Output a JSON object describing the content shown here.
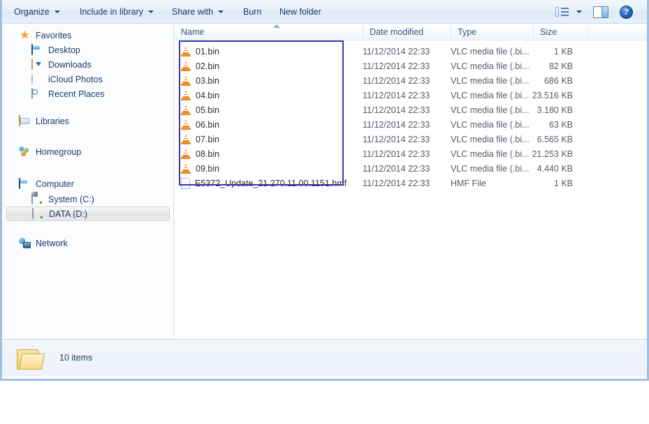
{
  "window": {
    "toolbar": {
      "organize_label": "Organize",
      "include_library_label": "Include in library",
      "share_with_label": "Share with",
      "burn_label": "Burn",
      "new_folder_label": "New folder",
      "views_icon": "view-options-icon",
      "views_caret_icon": "chevron-down-icon",
      "preview_pane_icon": "preview-pane-icon",
      "help_icon": "help-icon",
      "help_glyph": "?"
    },
    "sidebar": {
      "items": [
        {
          "label": "Favorites",
          "icon": "star-icon",
          "indent": 0,
          "selected": false
        },
        {
          "label": "Desktop",
          "icon": "desktop-icon",
          "indent": 1,
          "selected": false
        },
        {
          "label": "Downloads",
          "icon": "downloads-folder-icon",
          "indent": 1,
          "selected": false
        },
        {
          "label": "iCloud Photos",
          "icon": "icloud-photos-icon",
          "indent": 1,
          "selected": false
        },
        {
          "label": "Recent Places",
          "icon": "recent-places-icon",
          "indent": 1,
          "selected": false
        },
        {
          "label": "Libraries",
          "icon": "libraries-icon",
          "indent": 0,
          "selected": false
        },
        {
          "label": "Homegroup",
          "icon": "homegroup-icon",
          "indent": 0,
          "selected": false
        },
        {
          "label": "Computer",
          "icon": "computer-icon",
          "indent": 0,
          "selected": false
        },
        {
          "label": "System (C:)",
          "icon": "hard-drive-icon",
          "indent": 1,
          "selected": false
        },
        {
          "label": "DATA (D:)",
          "icon": "drive-icon",
          "indent": 1,
          "selected": true
        },
        {
          "label": "Network",
          "icon": "network-icon",
          "indent": 0,
          "selected": false
        }
      ]
    },
    "file_list": {
      "columns": {
        "name": "Name",
        "date_modified": "Date modified",
        "type": "Type",
        "size": "Size"
      },
      "sort_column": "Name",
      "sort_direction": "ascending",
      "rows": [
        {
          "name": "01.bin",
          "icon": "vlc-media-file-icon",
          "date": "11/12/2014 22:33",
          "type": "VLC media file (.bi...",
          "size": "1 KB"
        },
        {
          "name": "02.bin",
          "icon": "vlc-media-file-icon",
          "date": "11/12/2014 22:33",
          "type": "VLC media file (.bi...",
          "size": "82 KB"
        },
        {
          "name": "03.bin",
          "icon": "vlc-media-file-icon",
          "date": "11/12/2014 22:33",
          "type": "VLC media file (.bi...",
          "size": "686 KB"
        },
        {
          "name": "04.bin",
          "icon": "vlc-media-file-icon",
          "date": "11/12/2014 22:33",
          "type": "VLC media file (.bi...",
          "size": "23.516 KB"
        },
        {
          "name": "05.bin",
          "icon": "vlc-media-file-icon",
          "date": "11/12/2014 22:33",
          "type": "VLC media file (.bi...",
          "size": "3.180 KB"
        },
        {
          "name": "06.bin",
          "icon": "vlc-media-file-icon",
          "date": "11/12/2014 22:33",
          "type": "VLC media file (.bi...",
          "size": "63 KB"
        },
        {
          "name": "07.bin",
          "icon": "vlc-media-file-icon",
          "date": "11/12/2014 22:33",
          "type": "VLC media file (.bi...",
          "size": "6.565 KB"
        },
        {
          "name": "08.bin",
          "icon": "vlc-media-file-icon",
          "date": "11/12/2014 22:33",
          "type": "VLC media file (.bi...",
          "size": "21.253 KB"
        },
        {
          "name": "09.bin",
          "icon": "vlc-media-file-icon",
          "date": "11/12/2014 22:33",
          "type": "VLC media file (.bi...",
          "size": "4.440 KB"
        },
        {
          "name": "E5372_Update_21.270.11.00.1151.hmf",
          "icon": "generic-file-icon",
          "date": "11/12/2014 22:33",
          "type": "HMF File",
          "size": "1 KB"
        }
      ]
    },
    "annotation": {
      "shape": "rectangle",
      "color": "#3b35b5"
    },
    "status_bar": {
      "folder_icon": "open-folder-icon",
      "item_count_label": "10 items"
    }
  }
}
